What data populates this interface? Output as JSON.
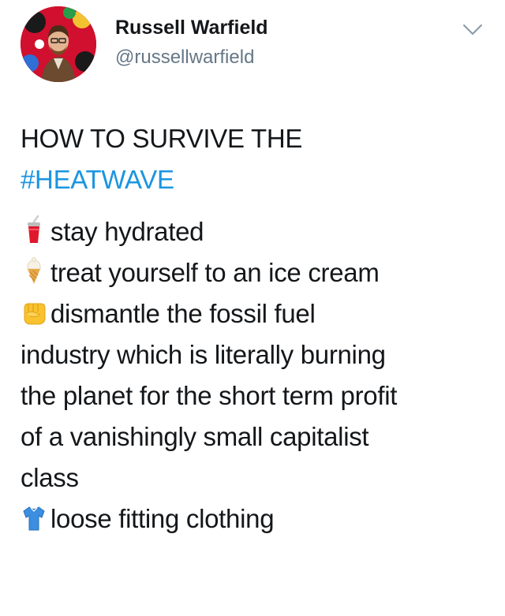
{
  "user": {
    "name": "Russell Warfield",
    "handle": "@russellwarfield"
  },
  "tweet": {
    "title_line": "HOW TO SURVIVE THE",
    "hashtag": "#HEATWAVE",
    "items": [
      {
        "icon": "cup-with-straw-icon",
        "text": "stay hydrated"
      },
      {
        "icon": "ice-cream-icon",
        "text": "treat yourself to an ice cream"
      },
      {
        "icon": "raised-fist-icon",
        "text": "dismantle the fossil fuel"
      },
      {
        "icon": "t-shirt-icon",
        "text": "loose fitting clothing"
      }
    ],
    "continuation_lines": [
      "industry which is literally burning",
      "the planet for the short term profit",
      "of a vanishingly small capitalist",
      "class"
    ]
  },
  "colors": {
    "hashtag": "#1b95e0",
    "text": "#14171a",
    "handle": "#657786"
  }
}
